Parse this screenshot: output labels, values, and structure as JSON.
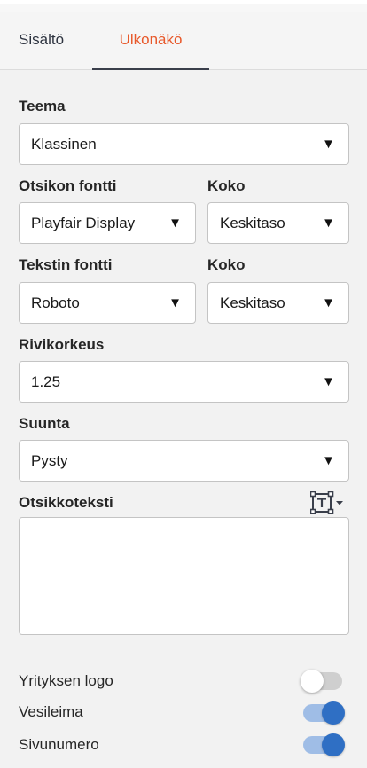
{
  "tabs": [
    {
      "label": "Sisältö",
      "active": false
    },
    {
      "label": "Ulkonäkö",
      "active": true
    }
  ],
  "theme": {
    "label": "Teema",
    "value": "Klassinen"
  },
  "heading_font": {
    "label": "Otsikon fontti",
    "value": "Playfair Display",
    "size_label": "Koko",
    "size_value": "Keskitaso"
  },
  "body_font": {
    "label": "Tekstin fontti",
    "value": "Roboto",
    "size_label": "Koko",
    "size_value": "Keskitaso"
  },
  "line_height": {
    "label": "Rivikorkeus",
    "value": "1.25"
  },
  "orientation": {
    "label": "Suunta",
    "value": "Pysty"
  },
  "header_text": {
    "label": "Otsikkoteksti",
    "value": ""
  },
  "toggles": [
    {
      "label": "Yrityksen logo",
      "on": false
    },
    {
      "label": "Vesileima",
      "on": true
    },
    {
      "label": "Sivunumero",
      "on": true
    }
  ],
  "colors": {
    "accent": "#e8582a",
    "toggle_on": "#2f6fc4",
    "toggle_track_on": "#9fbde6"
  },
  "icons": {
    "dropdown": "▼",
    "text-format": "text-frame-icon"
  }
}
